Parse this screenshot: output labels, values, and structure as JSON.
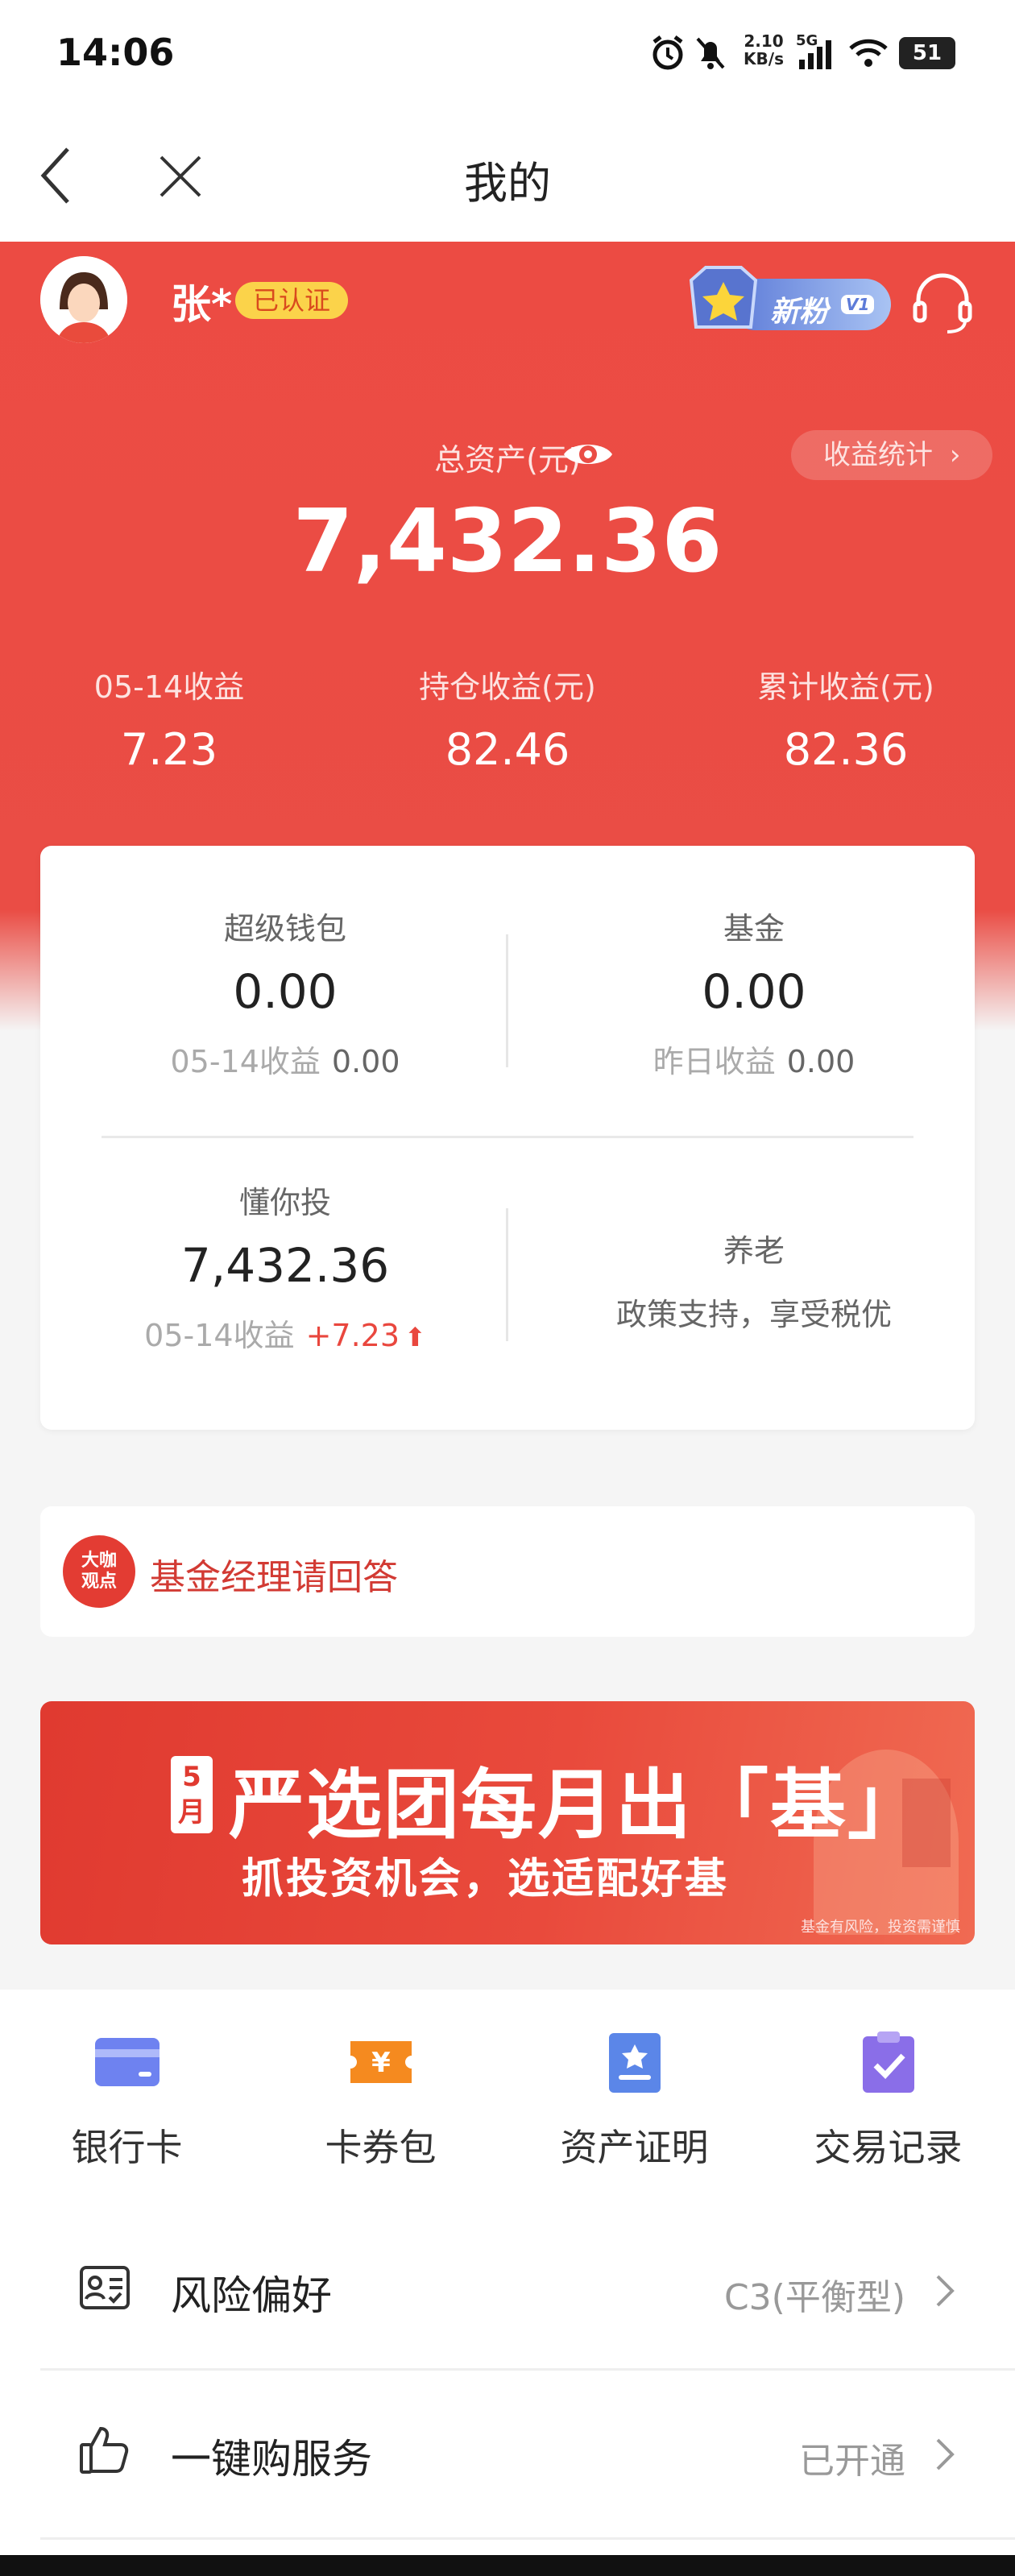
{
  "status_bar": {
    "time": "14:06",
    "net_speed_top": "2.10",
    "net_speed_unit": "KB/s",
    "network": "5G",
    "battery": "51"
  },
  "nav": {
    "title": "我的",
    "back_icon": "chevron-left-icon",
    "close_icon": "close-icon"
  },
  "profile": {
    "name": "张*",
    "verified_label": "已认证",
    "vip_label": "新粉",
    "vip_level": "V1"
  },
  "assets": {
    "total_label": "总资产(元)",
    "total_value": "7,432.36",
    "stats_button": "收益统计",
    "metrics": [
      {
        "label": "05-14收益",
        "value": "7.23"
      },
      {
        "label": "持仓收益(元)",
        "value": "82.46"
      },
      {
        "label": "累计收益(元)",
        "value": "82.36"
      }
    ]
  },
  "asset_card": {
    "wallet": {
      "title": "超级钱包",
      "value": "0.00",
      "sub_label": "05-14收益",
      "sub_value": "0.00"
    },
    "fund": {
      "title": "基金",
      "value": "0.00",
      "sub_label": "昨日收益",
      "sub_value": "0.00"
    },
    "advisor": {
      "title": "懂你投",
      "value": "7,432.36",
      "sub_label": "05-14收益",
      "sub_value": "+7.23"
    },
    "pension": {
      "title": "养老",
      "desc": "政策支持，享受税优"
    }
  },
  "manager_bar": {
    "badge_line1": "大咖",
    "badge_line2": "观点",
    "text": "基金经理请回答"
  },
  "promo": {
    "month_top": "5",
    "month_bottom": "月",
    "title": "严选团每月出「基」",
    "subtitle": "抓投资机会，选适配好基",
    "note": "基金有风险，投资需谨慎"
  },
  "shortcuts": [
    {
      "label": "银行卡",
      "icon": "bank-card-icon"
    },
    {
      "label": "卡券包",
      "icon": "coupon-icon"
    },
    {
      "label": "资产证明",
      "icon": "asset-certificate-icon"
    },
    {
      "label": "交易记录",
      "icon": "transaction-record-icon"
    }
  ],
  "list": [
    {
      "label": "风险偏好",
      "value": "C3(平衡型)",
      "icon": "risk-profile-icon"
    },
    {
      "label": "一键购服务",
      "value": "已开通",
      "icon": "thumbs-up-icon"
    }
  ],
  "colors": {
    "brand_red": "#ea4d45",
    "badge_yellow": "#fbd34a",
    "rise_red": "#e9473e"
  }
}
